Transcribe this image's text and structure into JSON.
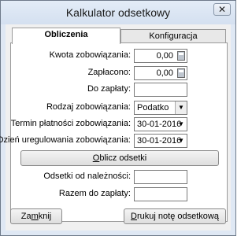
{
  "window": {
    "title": "Kalkulator odsetkowy",
    "close_symbol": "✕"
  },
  "tabs": [
    {
      "label": "Obliczenia",
      "active": true
    },
    {
      "label": "Konfiguracja",
      "active": false
    }
  ],
  "form": {
    "kwota_label": "Kwota zobowiązania:",
    "kwota_value": "0,00",
    "zaplacono_label": "Zapłacono:",
    "zaplacono_value": "0,00",
    "do_zaplaty_label": "Do zapłaty:",
    "do_zaplaty_value": "",
    "rodzaj_label": "Rodzaj zobowiązania:",
    "rodzaj_value": "Podatko",
    "termin_label": "Termin płatności zobowiązania:",
    "termin_value": "30-01-2016",
    "dzien_label": "Dzień uregulowania zobowiązania:",
    "dzien_value": "30-01-2016",
    "oblicz_button_accel": "O",
    "oblicz_button_rest": "blicz odsetki",
    "odsetki_label": "Odsetki od należności:",
    "odsetki_value": "",
    "razem_label": "Razem do zapłaty:",
    "razem_value": ""
  },
  "footer": {
    "zamknij_accel": "m",
    "zamknij_pre": "Za",
    "zamknij_post": "knij",
    "drukuj_pre": "",
    "drukuj_accel": "D",
    "drukuj_post": "rukuj notę odsetkową"
  },
  "icons": {
    "close": "close-icon",
    "calculator": "calculator-icon",
    "dropdown": "chevron-down-icon"
  }
}
